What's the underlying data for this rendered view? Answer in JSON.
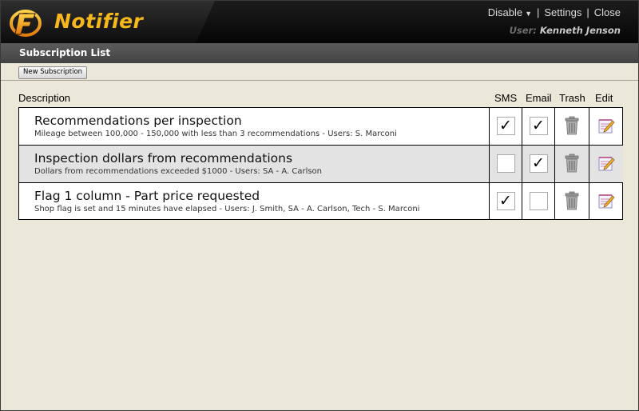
{
  "app": {
    "title": "Notifier"
  },
  "header": {
    "links": {
      "disable": "Disable",
      "settings": "Settings",
      "close": "Close"
    },
    "user_label": "User:",
    "user_name": "Kenneth Jenson"
  },
  "page": {
    "title": "Subscription List"
  },
  "toolbar": {
    "new_subscription": "New Subscription"
  },
  "table": {
    "columns": {
      "description": "Description",
      "sms": "SMS",
      "email": "Email",
      "trash": "Trash",
      "edit": "Edit"
    },
    "rows": [
      {
        "title": "Recommendations per inspection",
        "subtitle": "Mileage between 100,000 - 150,000 with less than 3 recommendations  -  Users:  S. Marconi",
        "sms": true,
        "email": true
      },
      {
        "title": "Inspection dollars from recommendations",
        "subtitle": "Dollars from recommendations exceeded $1000  -  Users:  SA - A. Carlson",
        "sms": false,
        "email": true
      },
      {
        "title": "Flag 1 column - Part price requested",
        "subtitle": "Shop flag is set and 15 minutes have elapsed  -  Users:  J. Smith,  SA - A. Carlson,  Tech - S. Marconi",
        "sms": true,
        "email": false
      }
    ]
  },
  "icons": {
    "logo": "notifier-logo-icon",
    "trash": "trash-can-icon",
    "edit": "edit-notepad-icon",
    "check": "checkmark-icon"
  },
  "colors": {
    "brand": "#f7b81c",
    "header_bg": "#0b0b0b",
    "subheader_bg": "#4e4e4e",
    "page_bg": "#ece8d9",
    "alt_row": "#e3e3e3"
  }
}
